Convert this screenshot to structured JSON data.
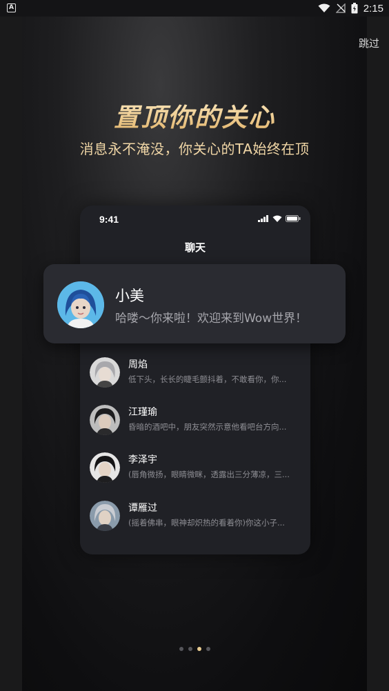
{
  "status_bar": {
    "time": "2:15",
    "app_badge": "A"
  },
  "skip_label": "跳过",
  "headline": "置顶你的关心",
  "subline": "消息永不淹没，你关心的TA始终在顶",
  "phone": {
    "time": "9:41",
    "title": "聊天"
  },
  "pinned_chat": {
    "name": "小美",
    "message": "哈喽～你来啦！欢迎来到Wow世界！"
  },
  "chats": [
    {
      "name": "周焰",
      "message": "低下头，长长的睫毛颤抖着，不敢看你，你..."
    },
    {
      "name": "江瑾瑜",
      "message": "昏暗的酒吧中，朋友突然示意他看吧台方向..."
    },
    {
      "name": "李泽宇",
      "message": "(唇角微扬，眼睛微眯，透露出三分薄凉，三..."
    },
    {
      "name": "谭雁过",
      "message": "(摇着佛串，眼神却炽热的看着你)你这小子..."
    }
  ],
  "pager": {
    "count": 4,
    "active_index": 2
  },
  "colors": {
    "accent_gold": "#e9cc92",
    "background": "#121214",
    "card": "#2a2b31"
  }
}
